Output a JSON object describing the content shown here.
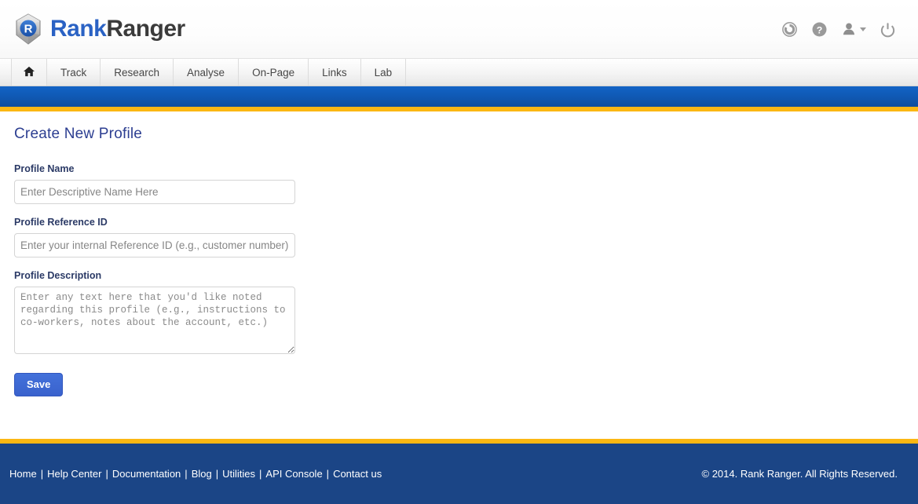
{
  "header": {
    "brand": {
      "first": "Rank",
      "second": "Ranger",
      "mark_letter": "R",
      "mark_icon": "hexagon-gem-icon"
    },
    "icons": [
      {
        "name": "refresh-icon",
        "title": "Refresh"
      },
      {
        "name": "help-icon",
        "title": "Help"
      },
      {
        "name": "user-icon",
        "title": "Account"
      },
      {
        "name": "power-icon",
        "title": "Log out"
      }
    ]
  },
  "nav": {
    "home_label": "",
    "items": [
      {
        "label": "Track"
      },
      {
        "label": "Research"
      },
      {
        "label": "Analyse"
      },
      {
        "label": "On-Page"
      },
      {
        "label": "Links"
      },
      {
        "label": "Lab"
      }
    ]
  },
  "main": {
    "title": "Create New Profile",
    "fields": [
      {
        "label": "Profile Name",
        "placeholder": "Enter Descriptive Name Here",
        "value": ""
      },
      {
        "label": "Profile Reference ID",
        "placeholder": "Enter your internal Reference ID (e.g., customer number)",
        "value": ""
      },
      {
        "label": "Profile Description",
        "placeholder": "Enter any text here that you'd like noted regarding this profile (e.g., instructions to co-workers, notes about the account, etc.)",
        "value": ""
      }
    ],
    "save_label": "Save"
  },
  "footer": {
    "links": [
      "Home",
      "Help Center",
      "Documentation",
      "Blog",
      "Utilities",
      "API Console",
      "Contact us"
    ],
    "separator": "|",
    "copyright": "© 2014. Rank Ranger. All Rights Reserved."
  },
  "colors": {
    "brand_blue": "#2a62c4",
    "brand_dark": "#3b3b3b",
    "band_blue": "#1059b4",
    "gold": "#fbb713",
    "footer_blue": "#1b4586",
    "title_navy": "#2c3e91",
    "save_blue": "#3a62cd"
  }
}
